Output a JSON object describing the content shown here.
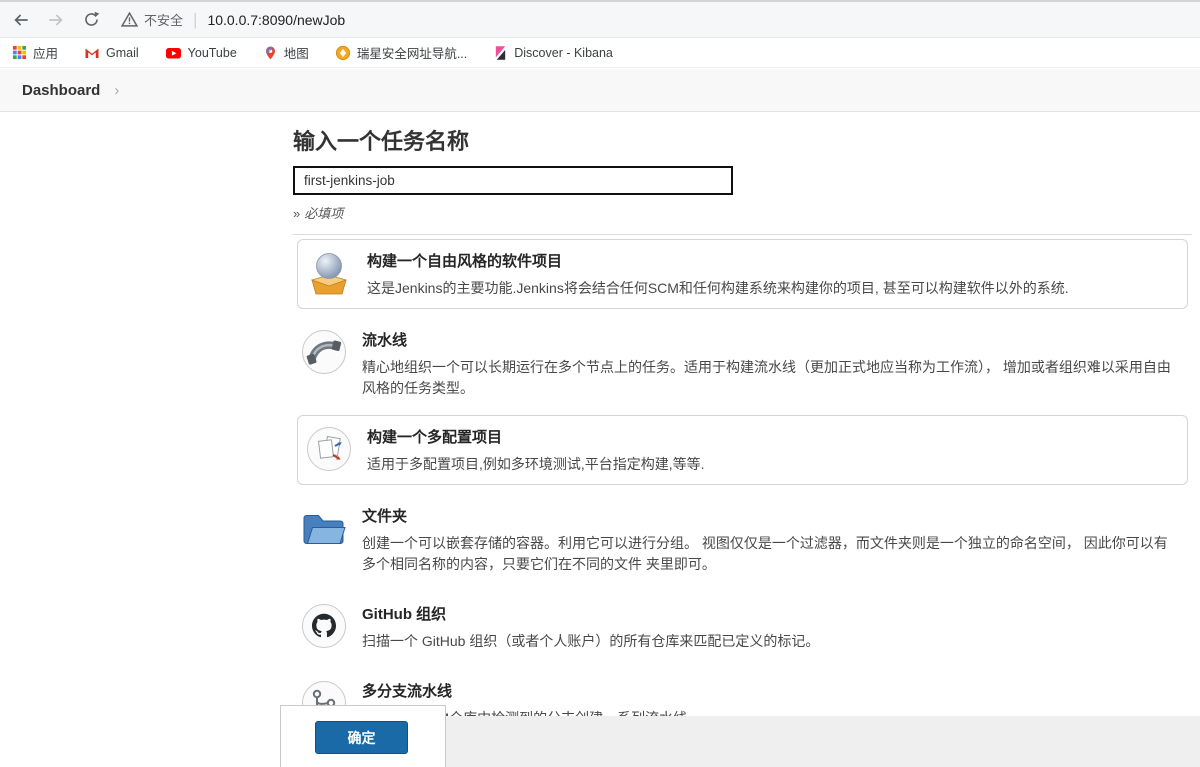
{
  "browser": {
    "security_label": "不安全",
    "url": "10.0.0.7:8090/newJob",
    "bookmarks": [
      {
        "label": "应用",
        "icon": "apps-grid-icon"
      },
      {
        "label": "Gmail",
        "icon": "gmail-icon"
      },
      {
        "label": "YouTube",
        "icon": "youtube-icon"
      },
      {
        "label": "地图",
        "icon": "maps-icon"
      },
      {
        "label": "瑞星安全网址导航...",
        "icon": "rising-icon"
      },
      {
        "label": "Discover - Kibana",
        "icon": "kibana-icon"
      }
    ]
  },
  "breadcrumb": {
    "items": [
      {
        "label": "Dashboard"
      }
    ],
    "separator": "›"
  },
  "main": {
    "heading": "输入一个任务名称",
    "name_field": {
      "value": "first-jenkins-job"
    },
    "required_marker": "»",
    "required_note": "必填项",
    "items": [
      {
        "title": "构建一个自由风格的软件项目",
        "desc": "这是Jenkins的主要功能.Jenkins将会结合任何SCM和任何构建系统来构建你的项目, 甚至可以构建软件以外的系统.",
        "icon": "freestyle-project-icon",
        "selected": true
      },
      {
        "title": "流水线",
        "desc": "精心地组织一个可以长期运行在多个节点上的任务。适用于构建流水线（更加正式地应当称为工作流）， 增加或者组织难以采用自由风格的任务类型。",
        "icon": "pipeline-icon",
        "selected": false
      },
      {
        "title": "构建一个多配置项目",
        "desc": "适用于多配置项目,例如多环境测试,平台指定构建,等等.",
        "icon": "multi-configuration-icon",
        "selected": true
      },
      {
        "title": "文件夹",
        "desc": "创建一个可以嵌套存储的容器。利用它可以进行分组。 视图仅仅是一个过滤器，而文件夹则是一个独立的命名空间， 因此你可以有多个相同名称的内容，只要它们在不同的文件 夹里即可。",
        "icon": "folder-icon",
        "selected": false
      },
      {
        "title": "GitHub 组织",
        "desc": "扫描一个 GitHub 组织（或者个人账户）的所有仓库来匹配已定义的标记。",
        "icon": "github-organization-icon",
        "selected": false
      },
      {
        "title": "多分支流水线",
        "desc": "根据一个SCM仓库中检测到的分支创建一系列流水线。",
        "icon": "multibranch-pipeline-icon",
        "selected": false
      }
    ],
    "ok_button": "确定"
  },
  "colors": {
    "ok_button_blue": "#1b6aa8",
    "breadcrumb_bar": "#f8f8f8",
    "footer_gray": "#efefef"
  }
}
